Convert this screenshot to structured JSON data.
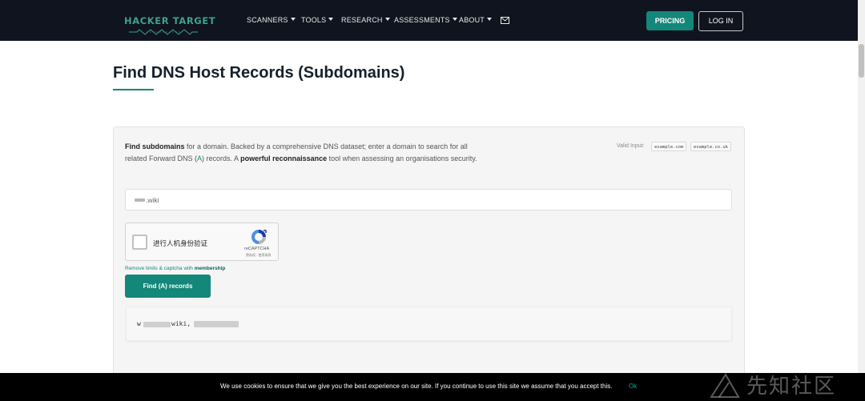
{
  "brand": {
    "name": "HACKER TARGET",
    "color": "#3fa08f"
  },
  "nav": {
    "items": [
      {
        "label": "SCANNERS",
        "dropdown": true
      },
      {
        "label": "TOOLS",
        "dropdown": true
      },
      {
        "label": "RESEARCH",
        "dropdown": true
      },
      {
        "label": "ASSESSMENTS",
        "dropdown": true
      },
      {
        "label": "ABOUT",
        "dropdown": true
      }
    ],
    "mail_icon": "envelope-icon",
    "pricing_label": "PRICING",
    "login_label": "LOG IN"
  },
  "page": {
    "title": "Find DNS Host Records (Subdomains)"
  },
  "tool": {
    "desc_bold1": "Find subdomains",
    "desc_part1": " for a domain. Backed by a comprehensive DNS dataset; enter a domain to search for all related Forward DNS (",
    "desc_record": "A",
    "desc_part2": ") records. A ",
    "desc_bold2": "powerful reconnaissance",
    "desc_part3": " tool when assessing an organisations security.",
    "valid_input_label": "Valid Input:",
    "valid_examples": [
      "example.com",
      "example.co.uk"
    ],
    "input_value": ".wiki",
    "captcha": {
      "label": "进行人机身份验证",
      "brand": "reCAPTCHA",
      "terms": "隐私权 - 使用条款"
    },
    "membership_text": "Remove limits & captcha with ",
    "membership_link": "membership",
    "submit_label": "Find (A) records",
    "result": {
      "prefix": "w",
      "domain": "wiki,"
    }
  },
  "cookie": {
    "message": "We use cookies to ensure that we give you the best experience on our site. If you continue to use this site we assume that you accept this.",
    "ok_label": "Ok"
  },
  "watermark": {
    "text": "先知社区"
  },
  "colors": {
    "accent": "#138779",
    "navbar": "#0f141e"
  }
}
